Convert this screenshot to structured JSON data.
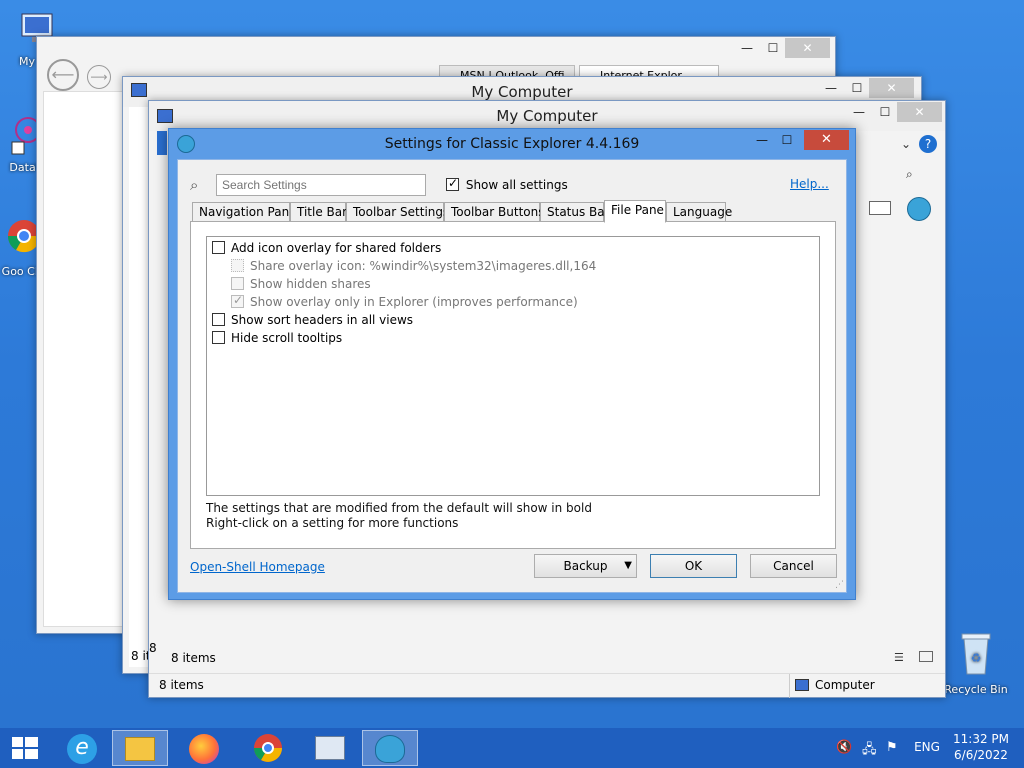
{
  "desktop": {
    "icons": [
      {
        "label": "My Co"
      },
      {
        "label": "DataW"
      },
      {
        "label": "Goo Chr"
      },
      {
        "label": "Recycle Bin"
      }
    ]
  },
  "windows": {
    "back": {
      "tab1": "MSN | Outlook, Offi",
      "tab2": "Internet Explor"
    },
    "middle": {
      "title": "My Computer",
      "status": "8 it"
    },
    "front": {
      "title": "My Computer",
      "status_items": "8 items",
      "status_location": "Computer",
      "left_count": "8"
    }
  },
  "dialog": {
    "title": "Settings for Classic Explorer 4.4.169",
    "search_placeholder": "Search Settings",
    "show_all_label": "Show all settings",
    "help_link": "Help...",
    "tabs": [
      {
        "label": "Navigation Pane"
      },
      {
        "label": "Title Bar"
      },
      {
        "label": "Toolbar Settings"
      },
      {
        "label": "Toolbar Buttons"
      },
      {
        "label": "Status Bar"
      },
      {
        "label": "File Pane"
      },
      {
        "label": "Language"
      }
    ],
    "active_tab": "File Pane",
    "settings": [
      {
        "label": "Add icon overlay for shared folders",
        "checked": false,
        "enabled": true
      },
      {
        "label": "Share overlay icon: %windir%\\system32\\imageres.dll,164",
        "checked": false,
        "enabled": false
      },
      {
        "label": "Show hidden shares",
        "checked": false,
        "enabled": false
      },
      {
        "label": "Show overlay only in Explorer (improves performance)",
        "checked": true,
        "enabled": false
      },
      {
        "label": "Show sort headers in all views",
        "checked": false,
        "enabled": true
      },
      {
        "label": "Hide scroll tooltips",
        "checked": false,
        "enabled": true
      }
    ],
    "note_line1": "The settings that are modified from the default will show in bold",
    "note_line2": "Right-click on a setting for more functions",
    "homepage_link": "Open-Shell Homepage",
    "backup_label": "Backup",
    "ok_label": "OK",
    "cancel_label": "Cancel"
  },
  "taskbar": {
    "language": "ENG",
    "time": "11:32 PM",
    "date": "6/6/2022"
  },
  "colors": {
    "desktop": "#2d7ad8",
    "taskbar": "#1f5fbf",
    "dialog_frame": "#5c9ce6",
    "close_red": "#c74b3c",
    "link": "#0066cc"
  }
}
